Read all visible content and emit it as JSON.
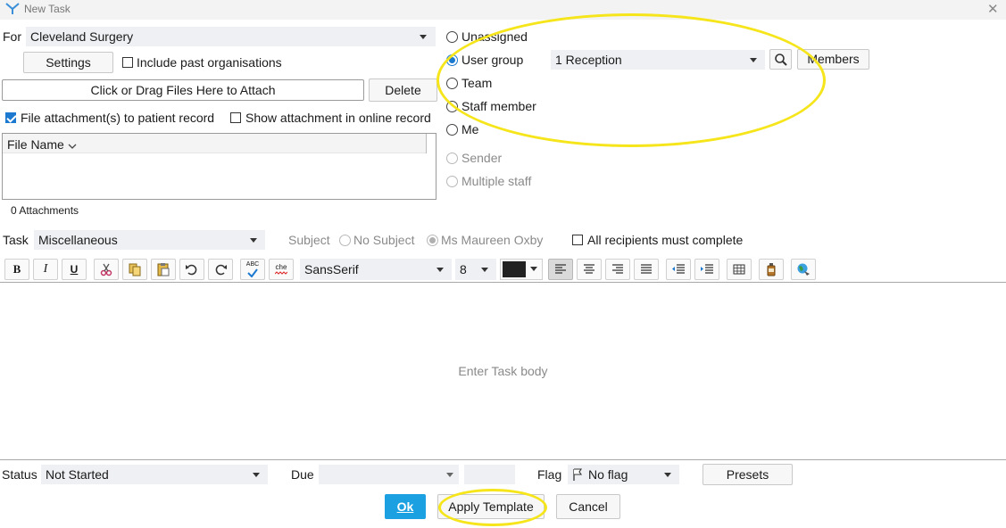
{
  "window": {
    "title": "New Task"
  },
  "for": {
    "label": "For",
    "value": "Cleveland Surgery"
  },
  "settings_button": "Settings",
  "include_past_orgs": {
    "label": "Include past organisations",
    "checked": false
  },
  "attach": {
    "drop_label": "Click or Drag Files Here to Attach",
    "delete_label": "Delete"
  },
  "file_to_record": {
    "label": "File attachment(s) to patient record",
    "checked": true
  },
  "show_online": {
    "label": "Show attachment in online record",
    "checked": false
  },
  "file_table": {
    "column_header": "File Name"
  },
  "attachments_count": "0 Attachments",
  "assign": {
    "options": [
      {
        "label": "Unassigned",
        "selected": false,
        "enabled": true
      },
      {
        "label": "User group",
        "selected": true,
        "enabled": true
      },
      {
        "label": "Team",
        "selected": false,
        "enabled": true
      },
      {
        "label": "Staff member",
        "selected": false,
        "enabled": true
      },
      {
        "label": "Me",
        "selected": false,
        "enabled": true
      },
      {
        "label": "Sender",
        "selected": false,
        "enabled": false
      },
      {
        "label": "Multiple staff",
        "selected": false,
        "enabled": false
      }
    ],
    "group_value": "1 Reception",
    "members_label": "Members"
  },
  "task": {
    "label": "Task",
    "value": "Miscellaneous"
  },
  "subject": {
    "label": "Subject",
    "options": [
      {
        "label": "No Subject",
        "selected": false
      },
      {
        "label": "Ms Maureen Oxby",
        "selected": true
      }
    ]
  },
  "all_recipients": {
    "label": "All recipients must complete",
    "checked": false
  },
  "toolbar": {
    "bold": "B",
    "italic": "I",
    "underline": "U",
    "font": "SansSerif",
    "size": "8",
    "text_color": "#222222",
    "spell_a": "ABC",
    "spell_b": "che"
  },
  "body": {
    "placeholder": "Enter Task body"
  },
  "status": {
    "label": "Status",
    "value": "Not Started"
  },
  "due": {
    "label": "Due",
    "value": ""
  },
  "flag": {
    "label": "Flag",
    "value": "No flag"
  },
  "presets_label": "Presets",
  "actions": {
    "ok": "Ok",
    "apply_template": "Apply Template",
    "cancel": "Cancel"
  },
  "colors": {
    "accent": "#1b79d0",
    "ok_button": "#1ba1e2",
    "highlight": "#f5e51a"
  }
}
